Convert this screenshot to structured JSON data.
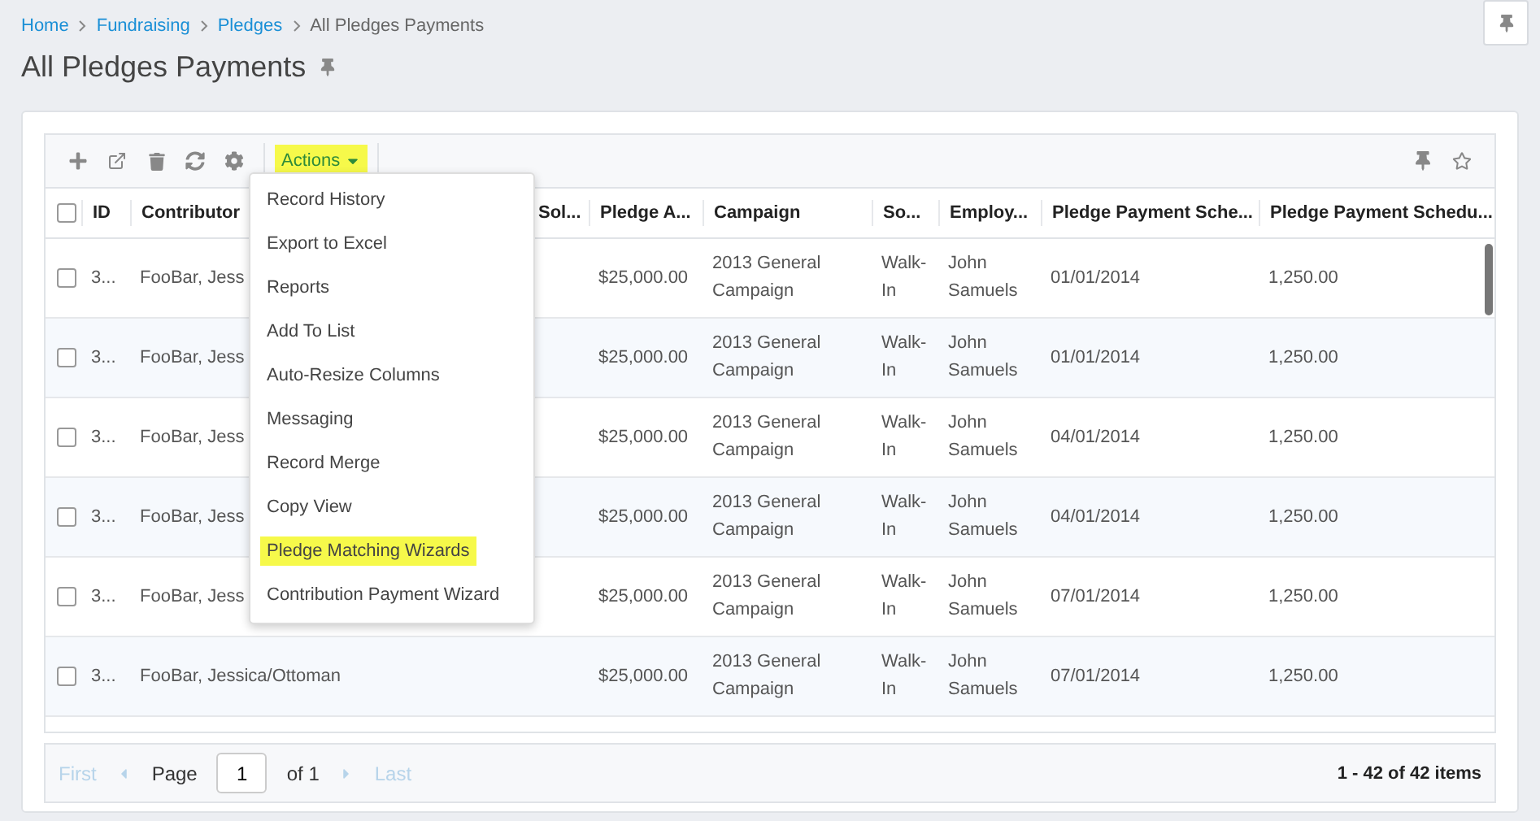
{
  "breadcrumbs": [
    {
      "label": "Home",
      "link": true
    },
    {
      "label": "Fundraising",
      "link": true
    },
    {
      "label": "Pledges",
      "link": true
    },
    {
      "label": "All Pledges Payments",
      "link": false
    }
  ],
  "title": "All Pledges Payments",
  "toolbar": {
    "actions_label": "Actions"
  },
  "actions_menu": [
    {
      "label": "Record History",
      "highlighted": false
    },
    {
      "label": "Export to Excel",
      "highlighted": false
    },
    {
      "label": "Reports",
      "highlighted": false
    },
    {
      "label": "Add To List",
      "highlighted": false
    },
    {
      "label": "Auto-Resize Columns",
      "highlighted": false
    },
    {
      "label": "Messaging",
      "highlighted": false
    },
    {
      "label": "Record Merge",
      "highlighted": false
    },
    {
      "label": "Copy View",
      "highlighted": false
    },
    {
      "label": "Pledge Matching Wizards",
      "highlighted": true
    },
    {
      "label": "Contribution Payment Wizard",
      "highlighted": false
    }
  ],
  "table": {
    "header_checked": false,
    "columns": [
      "ID",
      "Contributor",
      "Sol...",
      "Pledge A...",
      "Campaign",
      "So...",
      "Employ...",
      "Pledge Payment Sche...",
      "Pledge Payment Schedu..."
    ],
    "rows": [
      {
        "checked": false,
        "cells": [
          "3...",
          "FooBar, Jess",
          "",
          "$25,000.00",
          "2013 General Campaign",
          "Walk-In",
          "John Samuels",
          "01/01/2014",
          "1,250.00"
        ]
      },
      {
        "checked": false,
        "cells": [
          "3...",
          "FooBar, Jess",
          "",
          "$25,000.00",
          "2013 General Campaign",
          "Walk-In",
          "John Samuels",
          "01/01/2014",
          "1,250.00"
        ]
      },
      {
        "checked": false,
        "cells": [
          "3...",
          "FooBar, Jess",
          "",
          "$25,000.00",
          "2013 General Campaign",
          "Walk-In",
          "John Samuels",
          "04/01/2014",
          "1,250.00"
        ]
      },
      {
        "checked": false,
        "cells": [
          "3...",
          "FooBar, Jess",
          "",
          "$25,000.00",
          "2013 General Campaign",
          "Walk-In",
          "John Samuels",
          "04/01/2014",
          "1,250.00"
        ]
      },
      {
        "checked": false,
        "cells": [
          "3...",
          "FooBar, Jess",
          "",
          "$25,000.00",
          "2013 General Campaign",
          "Walk-In",
          "John Samuels",
          "07/01/2014",
          "1,250.00"
        ]
      },
      {
        "checked": false,
        "cells": [
          "3...",
          "FooBar, Jessica/Ottoman",
          "",
          "$25,000.00",
          "2013 General Campaign",
          "Walk-In",
          "John Samuels",
          "07/01/2014",
          "1,250.00"
        ]
      }
    ]
  },
  "pager": {
    "first": "First",
    "page_label": "Page",
    "page": "1",
    "of": "of 1",
    "last": "Last",
    "summary": "1 - 42 of 42 items"
  }
}
